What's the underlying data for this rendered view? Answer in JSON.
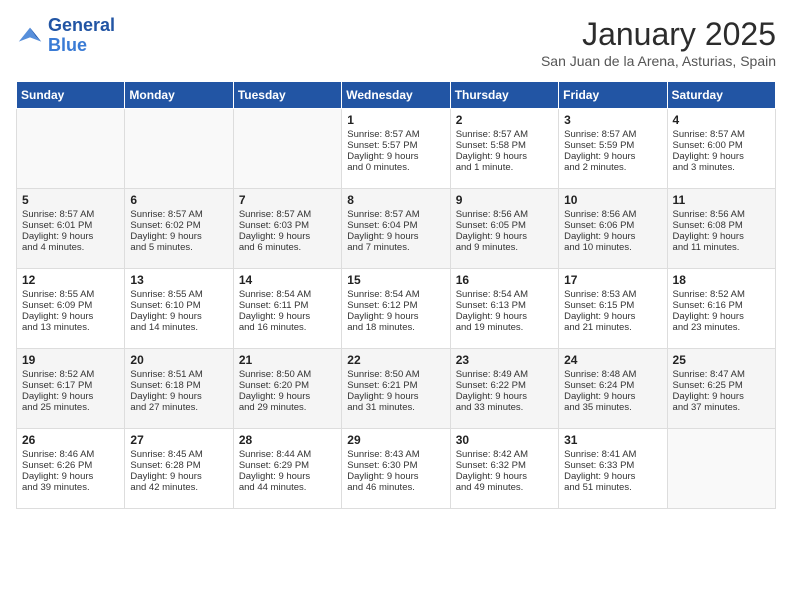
{
  "header": {
    "logo_line1": "General",
    "logo_line2": "Blue",
    "title": "January 2025",
    "subtitle": "San Juan de la Arena, Asturias, Spain"
  },
  "weekdays": [
    "Sunday",
    "Monday",
    "Tuesday",
    "Wednesday",
    "Thursday",
    "Friday",
    "Saturday"
  ],
  "weeks": [
    [
      {
        "day": "",
        "text": ""
      },
      {
        "day": "",
        "text": ""
      },
      {
        "day": "",
        "text": ""
      },
      {
        "day": "1",
        "text": "Sunrise: 8:57 AM\nSunset: 5:57 PM\nDaylight: 9 hours\nand 0 minutes."
      },
      {
        "day": "2",
        "text": "Sunrise: 8:57 AM\nSunset: 5:58 PM\nDaylight: 9 hours\nand 1 minute."
      },
      {
        "day": "3",
        "text": "Sunrise: 8:57 AM\nSunset: 5:59 PM\nDaylight: 9 hours\nand 2 minutes."
      },
      {
        "day": "4",
        "text": "Sunrise: 8:57 AM\nSunset: 6:00 PM\nDaylight: 9 hours\nand 3 minutes."
      }
    ],
    [
      {
        "day": "5",
        "text": "Sunrise: 8:57 AM\nSunset: 6:01 PM\nDaylight: 9 hours\nand 4 minutes."
      },
      {
        "day": "6",
        "text": "Sunrise: 8:57 AM\nSunset: 6:02 PM\nDaylight: 9 hours\nand 5 minutes."
      },
      {
        "day": "7",
        "text": "Sunrise: 8:57 AM\nSunset: 6:03 PM\nDaylight: 9 hours\nand 6 minutes."
      },
      {
        "day": "8",
        "text": "Sunrise: 8:57 AM\nSunset: 6:04 PM\nDaylight: 9 hours\nand 7 minutes."
      },
      {
        "day": "9",
        "text": "Sunrise: 8:56 AM\nSunset: 6:05 PM\nDaylight: 9 hours\nand 9 minutes."
      },
      {
        "day": "10",
        "text": "Sunrise: 8:56 AM\nSunset: 6:06 PM\nDaylight: 9 hours\nand 10 minutes."
      },
      {
        "day": "11",
        "text": "Sunrise: 8:56 AM\nSunset: 6:08 PM\nDaylight: 9 hours\nand 11 minutes."
      }
    ],
    [
      {
        "day": "12",
        "text": "Sunrise: 8:55 AM\nSunset: 6:09 PM\nDaylight: 9 hours\nand 13 minutes."
      },
      {
        "day": "13",
        "text": "Sunrise: 8:55 AM\nSunset: 6:10 PM\nDaylight: 9 hours\nand 14 minutes."
      },
      {
        "day": "14",
        "text": "Sunrise: 8:54 AM\nSunset: 6:11 PM\nDaylight: 9 hours\nand 16 minutes."
      },
      {
        "day": "15",
        "text": "Sunrise: 8:54 AM\nSunset: 6:12 PM\nDaylight: 9 hours\nand 18 minutes."
      },
      {
        "day": "16",
        "text": "Sunrise: 8:54 AM\nSunset: 6:13 PM\nDaylight: 9 hours\nand 19 minutes."
      },
      {
        "day": "17",
        "text": "Sunrise: 8:53 AM\nSunset: 6:15 PM\nDaylight: 9 hours\nand 21 minutes."
      },
      {
        "day": "18",
        "text": "Sunrise: 8:52 AM\nSunset: 6:16 PM\nDaylight: 9 hours\nand 23 minutes."
      }
    ],
    [
      {
        "day": "19",
        "text": "Sunrise: 8:52 AM\nSunset: 6:17 PM\nDaylight: 9 hours\nand 25 minutes."
      },
      {
        "day": "20",
        "text": "Sunrise: 8:51 AM\nSunset: 6:18 PM\nDaylight: 9 hours\nand 27 minutes."
      },
      {
        "day": "21",
        "text": "Sunrise: 8:50 AM\nSunset: 6:20 PM\nDaylight: 9 hours\nand 29 minutes."
      },
      {
        "day": "22",
        "text": "Sunrise: 8:50 AM\nSunset: 6:21 PM\nDaylight: 9 hours\nand 31 minutes."
      },
      {
        "day": "23",
        "text": "Sunrise: 8:49 AM\nSunset: 6:22 PM\nDaylight: 9 hours\nand 33 minutes."
      },
      {
        "day": "24",
        "text": "Sunrise: 8:48 AM\nSunset: 6:24 PM\nDaylight: 9 hours\nand 35 minutes."
      },
      {
        "day": "25",
        "text": "Sunrise: 8:47 AM\nSunset: 6:25 PM\nDaylight: 9 hours\nand 37 minutes."
      }
    ],
    [
      {
        "day": "26",
        "text": "Sunrise: 8:46 AM\nSunset: 6:26 PM\nDaylight: 9 hours\nand 39 minutes."
      },
      {
        "day": "27",
        "text": "Sunrise: 8:45 AM\nSunset: 6:28 PM\nDaylight: 9 hours\nand 42 minutes."
      },
      {
        "day": "28",
        "text": "Sunrise: 8:44 AM\nSunset: 6:29 PM\nDaylight: 9 hours\nand 44 minutes."
      },
      {
        "day": "29",
        "text": "Sunrise: 8:43 AM\nSunset: 6:30 PM\nDaylight: 9 hours\nand 46 minutes."
      },
      {
        "day": "30",
        "text": "Sunrise: 8:42 AM\nSunset: 6:32 PM\nDaylight: 9 hours\nand 49 minutes."
      },
      {
        "day": "31",
        "text": "Sunrise: 8:41 AM\nSunset: 6:33 PM\nDaylight: 9 hours\nand 51 minutes."
      },
      {
        "day": "",
        "text": ""
      }
    ]
  ]
}
